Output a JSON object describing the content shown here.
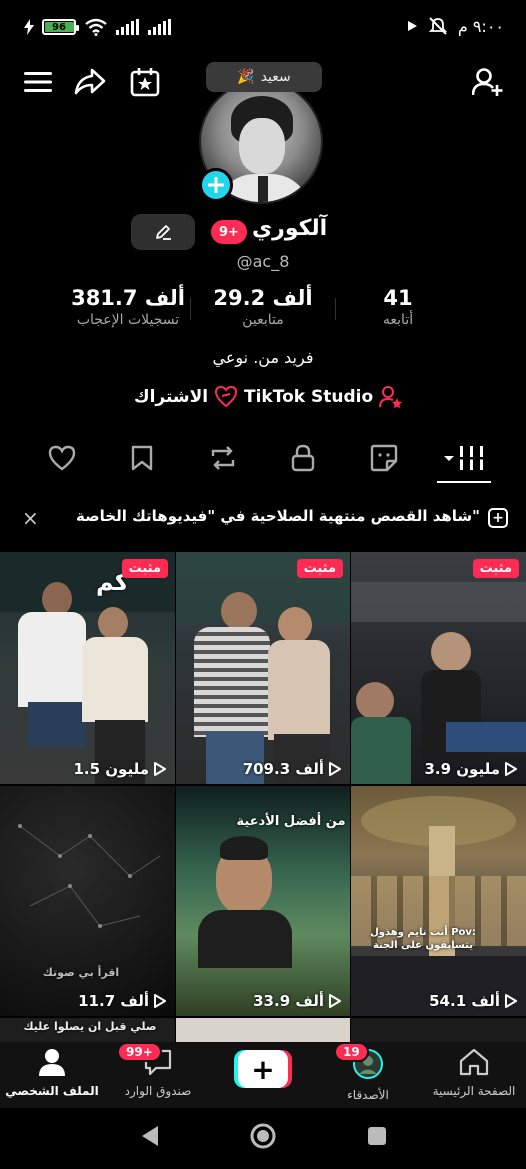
{
  "status_bar": {
    "battery": "96",
    "time": "٩:٠٠ م"
  },
  "top_bar": {
    "mood_label": "سعيد",
    "mood_emoji": "🎉"
  },
  "profile": {
    "display_name": "آلكوري",
    "notification_badge": "9+",
    "username": "@ac_8",
    "bio": "فريد من. نوعي"
  },
  "stats": {
    "following": {
      "value": "41",
      "label": "أتابعه"
    },
    "followers": {
      "value": "29.2 ألف",
      "label": "متابعين"
    },
    "likes": {
      "value": "381.7 ألف",
      "label": "تسجيلات الإعجاب"
    }
  },
  "links": {
    "studio": "TikTok Studio",
    "subscription": "الاشتراك"
  },
  "banner": {
    "text": "شاهد القصص منتهية الصلاحية في \"فيديوهاتك الخاصة\"",
    "close": "×",
    "plus": "+"
  },
  "videos": [
    {
      "pinned": "مثبت",
      "views": "3.9 مليون"
    },
    {
      "pinned": "مثبت",
      "views": "709.3 ألف"
    },
    {
      "pinned": "مثبت",
      "views": "1.5 مليون",
      "overlay": "كم"
    },
    {
      "views": "54.1 ألف",
      "overlay": "أنت نايم وهذول Pov: يتسابقون على الجنة"
    },
    {
      "views": "33.9 ألف",
      "overlay": "من أفضل الأدعية"
    },
    {
      "views": "11.7 ألف",
      "overlay": "اقرأ بي صوتك"
    },
    {
      "overlay": "صلي قبل ان يصلوا عليك"
    }
  ],
  "bottom_nav": {
    "home": "الصفحة الرئيسية",
    "friends": "الأصدقاء",
    "friends_badge": "19",
    "create": "+",
    "inbox": "صندوق الوارد",
    "inbox_badge": "99+",
    "profile": "الملف الشخصي"
  },
  "colors": {
    "accent_red": "#fe2c55",
    "accent_cyan": "#25f4ee",
    "background": "#000000"
  }
}
